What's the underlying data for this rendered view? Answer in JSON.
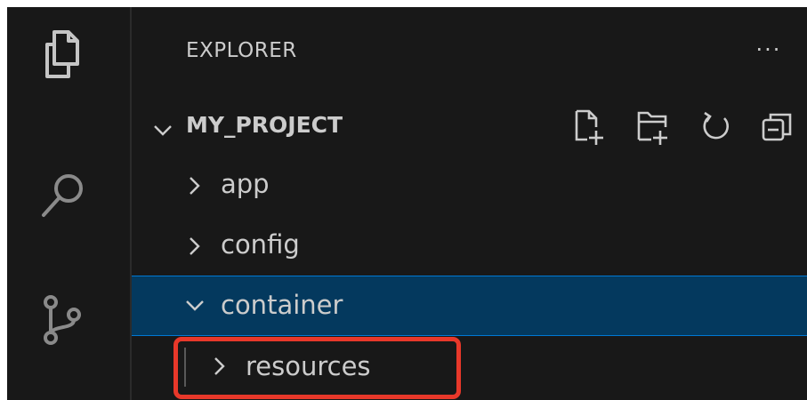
{
  "activity_bar": {
    "icons": [
      "files-icon",
      "search-icon",
      "source-control-icon"
    ]
  },
  "explorer": {
    "title": "EXPLORER",
    "more_actions": "···"
  },
  "project": {
    "name": "MY_PROJECT",
    "toolbar": [
      "new-file-icon",
      "new-folder-icon",
      "refresh-icon",
      "collapse-all-icon"
    ]
  },
  "tree": {
    "items": [
      {
        "label": "app",
        "expanded": false,
        "selected": false
      },
      {
        "label": "config",
        "expanded": false,
        "selected": false
      },
      {
        "label": "container",
        "expanded": true,
        "selected": true
      },
      {
        "label": "resources",
        "expanded": false,
        "selected": false
      }
    ]
  },
  "colors": {
    "background": "#181818",
    "text": "#cccccc",
    "selection": "#04395e",
    "selection_border": "#0078d4",
    "highlight_annotation": "#e8382a"
  }
}
